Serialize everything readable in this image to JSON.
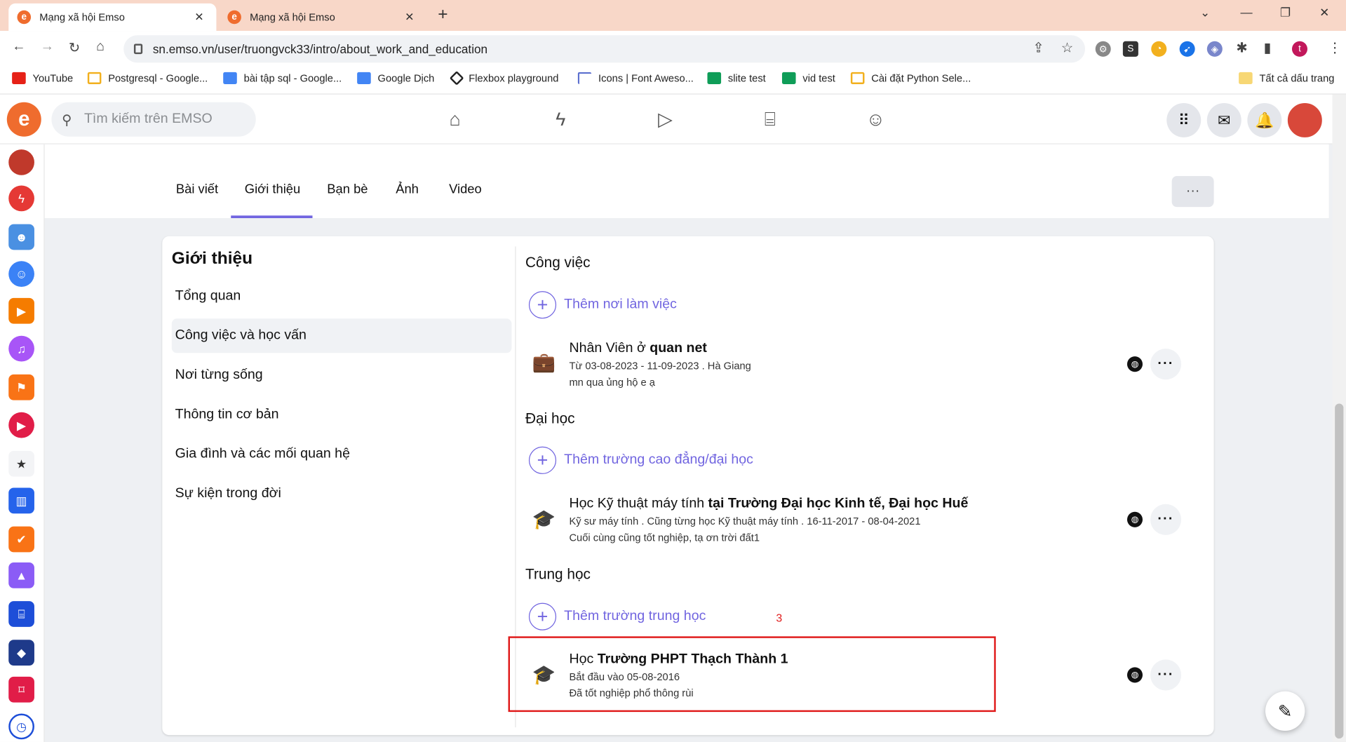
{
  "browser": {
    "tabs": [
      {
        "title": "Mạng xã hội Emso",
        "active": true
      },
      {
        "title": "Mạng xã hội Emso",
        "active": false
      }
    ],
    "new_tab": "+",
    "url": "sn.emso.vn/user/truongvck33/intro/about_work_and_education",
    "profile_initial": "t",
    "bookmarks": [
      "YouTube",
      "Postgresql - Google...",
      "bài tập sql - Google...",
      "Google Dịch",
      "Flexbox playground",
      "Icons | Font Aweso...",
      "slite test",
      "vid test",
      "Cài đặt Python Sele...",
      "Tất cả dấu trang"
    ]
  },
  "app": {
    "logo": "e",
    "search_placeholder": "Tìm kiếm trên EMSO",
    "nav_icons": [
      "home-icon",
      "bolt-icon",
      "video-icon",
      "store-icon",
      "groups-icon"
    ]
  },
  "profile_tabs": [
    "Bài viết",
    "Giới thiệu",
    "Bạn bè",
    "Ảnh",
    "Video"
  ],
  "active_profile_tab": "Giới thiệu",
  "more_button": "···",
  "intro": {
    "title": "Giới thiệu",
    "menu": [
      "Tổng quan",
      "Công việc và học vấn",
      "Nơi từng sống",
      "Thông tin cơ bản",
      "Gia đình và các mối quan hệ",
      "Sự kiện trong đời"
    ],
    "selected_menu": "Công việc và học vấn"
  },
  "work": {
    "heading": "Công việc",
    "add_label": "Thêm nơi làm việc",
    "entry": {
      "prefix": "Nhân Viên ở ",
      "bold": "quan net",
      "line2": "Từ 03-08-2023 - 11-09-2023 . Hà Giang",
      "line3": "mn qua ủng hộ e ạ"
    }
  },
  "university": {
    "heading": "Đại học",
    "add_label": "Thêm trường cao đẳng/đại học",
    "entry": {
      "prefix": "Học Kỹ thuật máy tính ",
      "bold": "tại Trường Đại học Kinh tế, Đại học Huế",
      "line2": "Kỹ sư máy tính . Cũng từng học Kỹ thuật máy tính . 16-11-2017 - 08-04-2021",
      "line3": "Cuối cùng cũng tốt nghiệp, tạ ơn trời đất1"
    }
  },
  "highschool": {
    "heading": "Trung học",
    "add_label": "Thêm trường trung học",
    "entry": {
      "prefix": "Học ",
      "bold": "Trường PHPT Thạch Thành 1",
      "line2": "Bắt đầu vào 05-08-2016",
      "line3": "Đã tốt nghiệp phổ thông rùi"
    }
  },
  "annotation": "3",
  "colors": {
    "accent": "#7165e0",
    "brand": "#ef6c2e",
    "highlight": "#e01a1a"
  }
}
